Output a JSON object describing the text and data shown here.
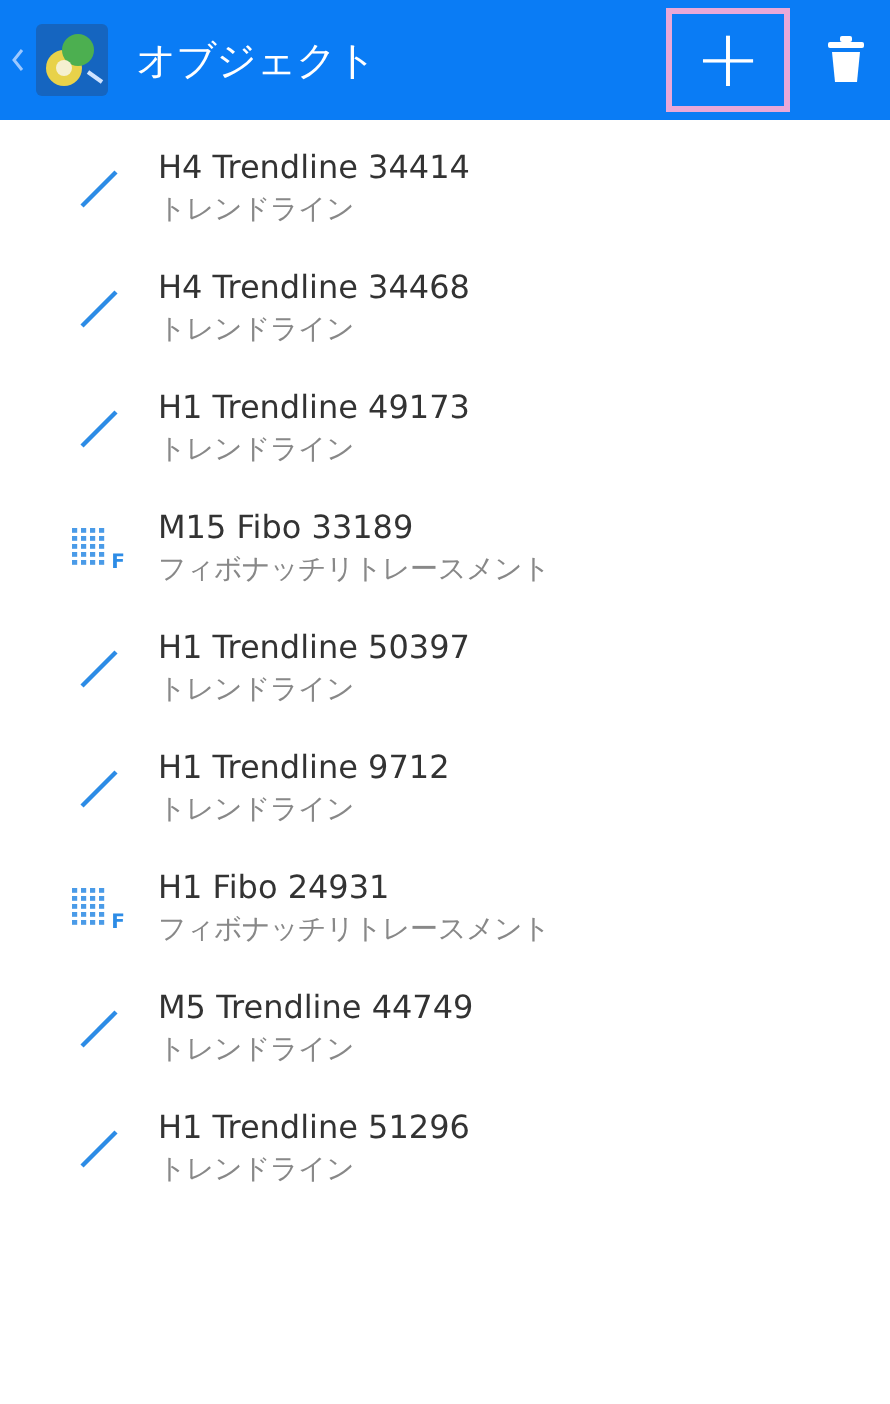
{
  "header": {
    "title": "オブジェクト",
    "add_button": {
      "label": "+",
      "highlighted": true
    }
  },
  "objects": [
    {
      "kind": "trendline",
      "name": "H4 Trendline 34414",
      "type": "トレンドライン"
    },
    {
      "kind": "trendline",
      "name": "H4 Trendline 34468",
      "type": "トレンドライン"
    },
    {
      "kind": "trendline",
      "name": "H1 Trendline 49173",
      "type": "トレンドライン"
    },
    {
      "kind": "fibo",
      "icon_letter": "F",
      "name": "M15 Fibo 33189",
      "type": "フィボナッチリトレースメント"
    },
    {
      "kind": "trendline",
      "name": "H1 Trendline 50397",
      "type": "トレンドライン"
    },
    {
      "kind": "trendline",
      "name": "H1 Trendline 9712",
      "type": "トレンドライン"
    },
    {
      "kind": "fibo",
      "icon_letter": "F",
      "name": "H1 Fibo 24931",
      "type": "フィボナッチリトレースメント"
    },
    {
      "kind": "trendline",
      "name": "M5 Trendline 44749",
      "type": "トレンドライン"
    },
    {
      "kind": "trendline",
      "name": "H1 Trendline 51296",
      "type": "トレンドライン"
    }
  ]
}
